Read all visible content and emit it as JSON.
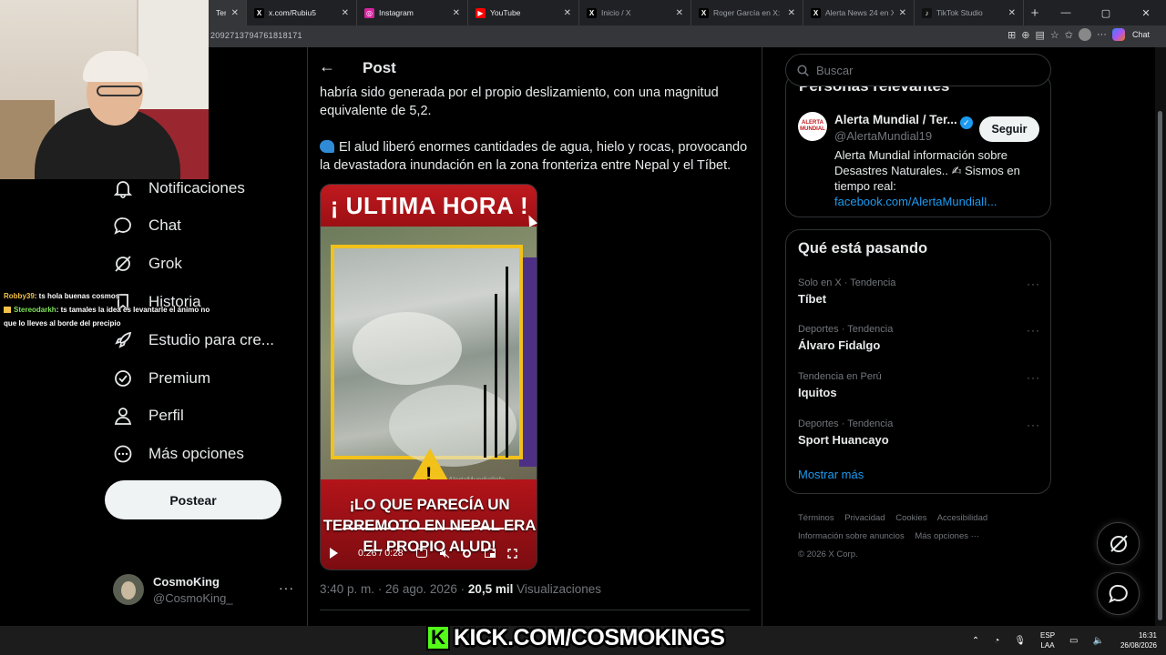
{
  "browser": {
    "tabs": [
      {
        "label": "Terrem",
        "favicon": "x-icon",
        "active": true
      },
      {
        "label": "x.com/Rubiu5",
        "favicon": "x-icon"
      },
      {
        "label": "Instagram",
        "favicon": "instagram-icon"
      },
      {
        "label": "YouTube",
        "favicon": "youtube-icon"
      },
      {
        "label": "Inicio / X",
        "favicon": "x-icon",
        "dim": true
      },
      {
        "label": "Roger García en X: \"",
        "favicon": "x-icon",
        "dim": true
      },
      {
        "label": "Alerta News 24 en X: \"",
        "favicon": "x-icon",
        "dim": true
      },
      {
        "label": "TikTok Studio",
        "favicon": "tiktok-icon",
        "dim": true
      }
    ],
    "url": "2092713794761818171",
    "chat_label": "Chat"
  },
  "nav": {
    "items": [
      {
        "label": "Notificaciones",
        "icon": "bell-icon"
      },
      {
        "label": "Chat",
        "icon": "chat-bubble-icon"
      },
      {
        "label": "Grok",
        "icon": "grok-icon"
      },
      {
        "label": "Historia",
        "icon": "bookmark-icon"
      },
      {
        "label": "Estudio para cre...",
        "icon": "rocket-icon"
      },
      {
        "label": "Premium",
        "icon": "verified-badge-icon"
      },
      {
        "label": "Perfil",
        "icon": "person-icon"
      },
      {
        "label": "Más opciones",
        "icon": "more-circle-icon"
      }
    ],
    "post_button": "Postear",
    "account": {
      "name": "CosmoKing",
      "handle": "@CosmoKing_",
      "more": "···"
    }
  },
  "stream_chat": [
    {
      "user": "Robby39",
      "text": ": ts hola buenas cosmos"
    },
    {
      "user": "Stereodarkh",
      "text": ": ts tamales la idea es levantarle el ánimo no que lo lleves al borde del precipio"
    }
  ],
  "post": {
    "header_title": "Post",
    "paragraph1": "habría sido generada por el propio deslizamiento, con una magnitud equivalente de 5,2.",
    "paragraph2": "El alud liberó enormes cantidades de agua, hielo y rocas, provocando la devastadora inundación en la zona fronteriza entre Nepal y el Tíbet.",
    "video": {
      "headline": "¡ ULTIMA HORA !",
      "watermark": "AlertaMundialInfo",
      "caption": "¡LO QUE PARECÍA UN TERREMOTO EN NEPAL ERA EL PROPIO ALUD!",
      "time": "0:26 / 0:28",
      "progress": 0.93
    },
    "time": "3:40 p. m.",
    "date": "26 ago. 2026",
    "views": "20,5 mil",
    "views_label": "Visualizaciones"
  },
  "right": {
    "search_placeholder": "Buscar",
    "relevant_header": "Personas relevantes",
    "account": {
      "name": "Alerta Mundial / Ter...",
      "handle": "@AlertaMundial19",
      "logo_text": "ALERTA MUNDIAL",
      "follow": "Seguir",
      "bio": "Alerta Mundial información sobre Desastres Naturales.. ✍ Sismos en tiempo real:",
      "link": "facebook.com/AlertaMundialI..."
    },
    "trends_title": "Qué está pasando",
    "trends": [
      {
        "context": "Solo en X · Tendencia",
        "name": "Tíbet"
      },
      {
        "context": "Deportes · Tendencia",
        "name": "Álvaro Fidalgo"
      },
      {
        "context": "Tendencia en Perú",
        "name": "Iquitos"
      },
      {
        "context": "Deportes · Tendencia",
        "name": "Sport Huancayo"
      }
    ],
    "show_more": "Mostrar más",
    "footer": [
      "Términos",
      "Privacidad",
      "Cookies",
      "Accesibilidad",
      "Información sobre anuncios",
      "Más opciones ···",
      "© 2026 X Corp."
    ]
  },
  "taskbar": {
    "brand": "KICK.COM/COSMOKINGS",
    "lang1": "ESP",
    "lang2": "LAA",
    "time": "16:31",
    "date": "26/08/2026"
  }
}
